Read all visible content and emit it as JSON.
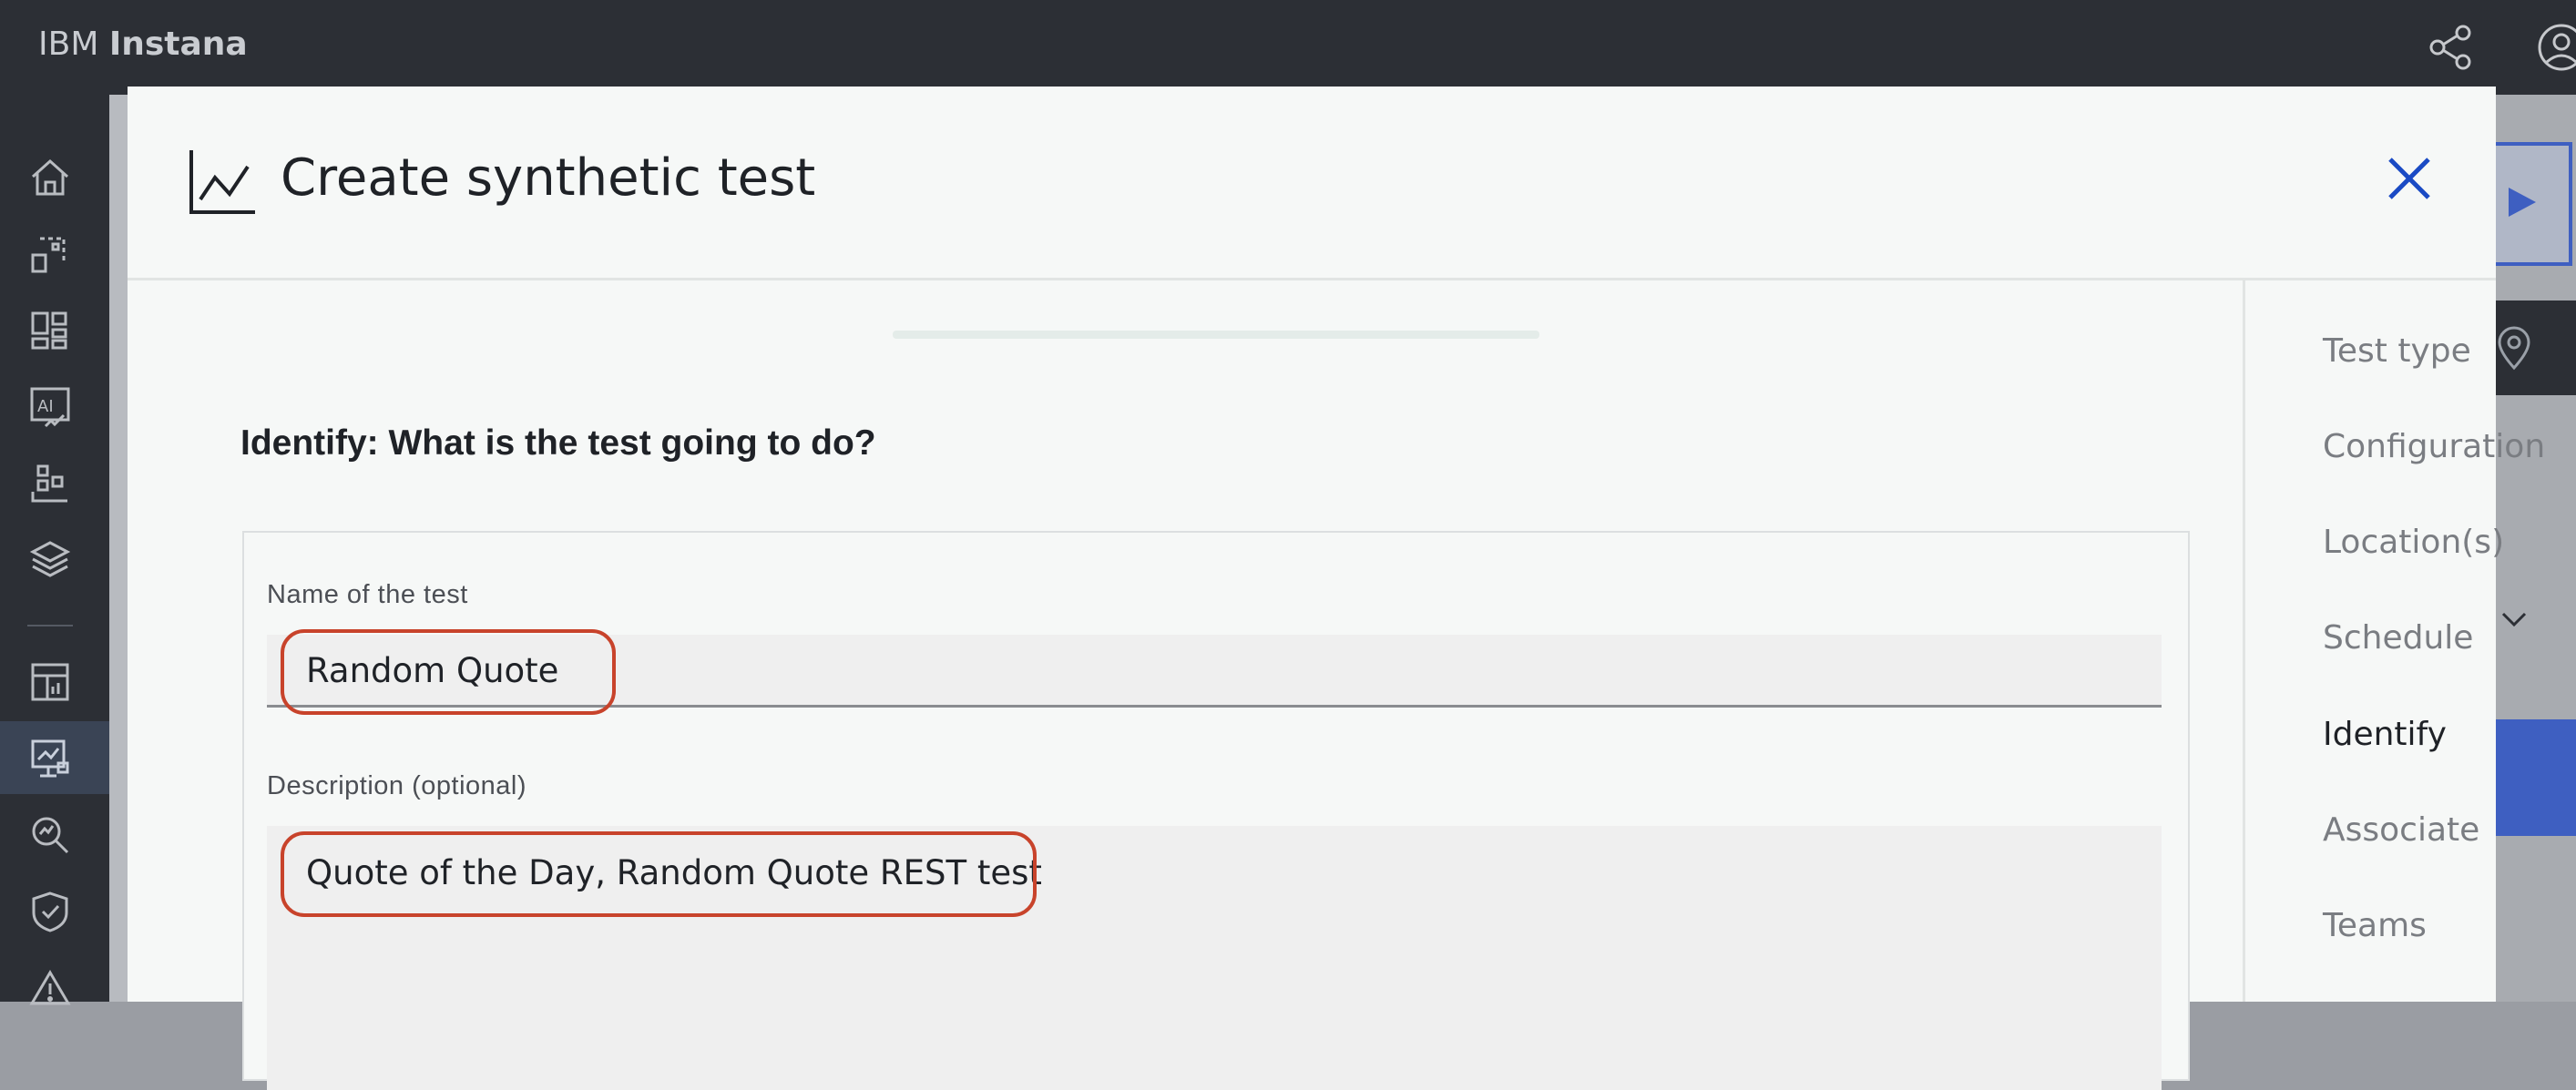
{
  "app": {
    "brand_prefix": "IBM ",
    "brand_name": "Instana"
  },
  "header_icons": [
    "share-icon",
    "user-profile-icon"
  ],
  "nav": {
    "items": [
      {
        "icon": "home-icon"
      },
      {
        "icon": "infrastructure-map-icon"
      },
      {
        "icon": "applications-icon"
      },
      {
        "icon": "ai-monitoring-icon"
      },
      {
        "icon": "services-icon"
      },
      {
        "icon": "layers-icon"
      },
      {
        "icon": "dashboard-icon"
      },
      {
        "icon": "synthetic-monitoring-icon",
        "active": true
      },
      {
        "icon": "analyze-icon"
      },
      {
        "icon": "security-icon"
      },
      {
        "icon": "alerts-icon"
      }
    ]
  },
  "modal": {
    "title": "Create synthetic test",
    "icon": "line-chart-icon",
    "close_icon": "close-icon",
    "section_heading": "Identify: What is the test going to do?",
    "name_field": {
      "label": "Name of the test",
      "value": "Random Quote"
    },
    "description_field": {
      "label": "Description (optional)",
      "value": "Quote of the Day, Random Quote REST test"
    },
    "steps": [
      "Test type",
      "Configuration",
      "Location(s)",
      "Schedule",
      "Identify",
      "Associate",
      "Teams"
    ],
    "current_step": "Identify",
    "highlight_color": "#c8432b",
    "accent_color": "#0f62fe"
  }
}
